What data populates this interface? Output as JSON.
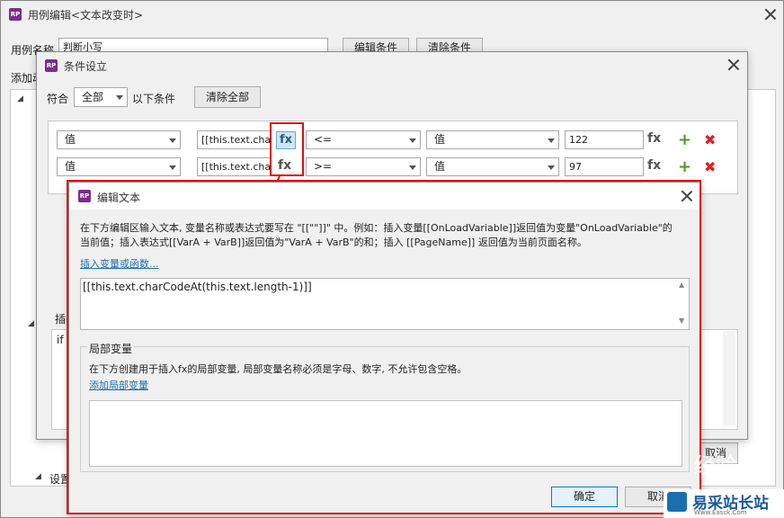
{
  "outer": {
    "title": "用例编辑<文本改变时>",
    "case_name_label": "用例名称",
    "case_name_value": "判断小写",
    "edit_conditions": "编辑条件",
    "clear_conditions": "清除条件",
    "add_action_partial": "添加动",
    "bottom_partial": "设置",
    "cancel_partial": "取消",
    "left_partial_1": "插",
    "left_partial_2": "if"
  },
  "cond": {
    "title": "条件设立",
    "match_label": "符合",
    "match_value": "全部",
    "match_suffix": "以下条件",
    "clear_all": "清除全部",
    "rows": [
      {
        "type": "值",
        "expr": "[[this.text.charCodeAt(this.text.length-1)]]",
        "fx": "fx",
        "op": "<=",
        "type2": "值",
        "value": "122",
        "fx2": "fx"
      },
      {
        "type": "值",
        "expr": "[[this.text.charCodeAt(this.text.length-1)]]",
        "fx": "fx",
        "op": ">=",
        "type2": "值",
        "value": "97",
        "fx2": "fx"
      }
    ]
  },
  "edit": {
    "title": "编辑文本",
    "desc_line1": "在下方编辑区输入文本, 变量名称或表达式要写在 \"[[\"\"]]\" 中。例如：插入变量[[OnLoadVariable]]返回值为变量\"OnLoadVariable\"的",
    "desc_line2": "当前值；插入表达式[[VarA + VarB]]返回值为\"VarA + VarB\"的和；插入 [[PageName]] 返回值为当前页面名称。",
    "insert_link": "插入变量或函数...",
    "editor_value": "[[this.text.charCodeAt(this.text.length-1)]]",
    "local_vars_title": "局部变量",
    "local_vars_desc": "在下方创建用于插入fx的局部变量, 局部变量名称必须是字母、数字, 不允许包含空格。",
    "add_local_link": "添加局部变量",
    "ok": "确定",
    "cancel": "取消"
  },
  "watermark": {
    "text1": "经验",
    "text2": "易采站长站",
    "text3": "Www.Easck.Com"
  },
  "colors": {
    "highlight": "#dd1111",
    "accent": "#7b2d8e",
    "link": "#1a6fb0"
  }
}
